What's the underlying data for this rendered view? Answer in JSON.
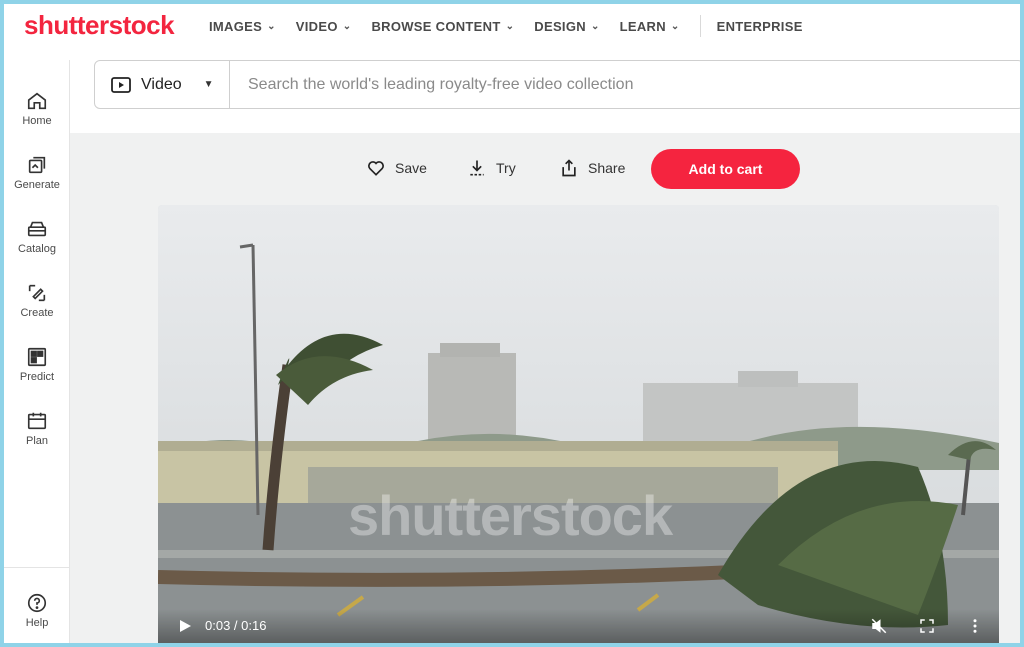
{
  "brand": {
    "logo_text": "shutterstock",
    "color": "#f3253f"
  },
  "nav": {
    "items": [
      {
        "label": "IMAGES",
        "has_dropdown": true
      },
      {
        "label": "VIDEO",
        "has_dropdown": true
      },
      {
        "label": "BROWSE CONTENT",
        "has_dropdown": true
      },
      {
        "label": "DESIGN",
        "has_dropdown": true
      },
      {
        "label": "LEARN",
        "has_dropdown": true
      },
      {
        "label": "ENTERPRISE",
        "has_dropdown": false
      }
    ]
  },
  "sidebar": {
    "items": [
      {
        "label": "Home",
        "icon": "home-icon"
      },
      {
        "label": "Generate",
        "icon": "generate-icon"
      },
      {
        "label": "Catalog",
        "icon": "catalog-icon"
      },
      {
        "label": "Create",
        "icon": "create-icon"
      },
      {
        "label": "Predict",
        "icon": "predict-icon"
      },
      {
        "label": "Plan",
        "icon": "plan-icon"
      }
    ],
    "help": {
      "label": "Help",
      "icon": "help-icon"
    }
  },
  "search": {
    "type_label": "Video",
    "placeholder": "Search the world's leading royalty-free video collection",
    "value": ""
  },
  "actions": {
    "save_label": "Save",
    "try_label": "Try",
    "share_label": "Share",
    "cart_label": "Add to cart",
    "cart_color": "#f5243f"
  },
  "video": {
    "watermark": "shutterstock",
    "time": "0:03 / 0:16",
    "muted": true
  }
}
